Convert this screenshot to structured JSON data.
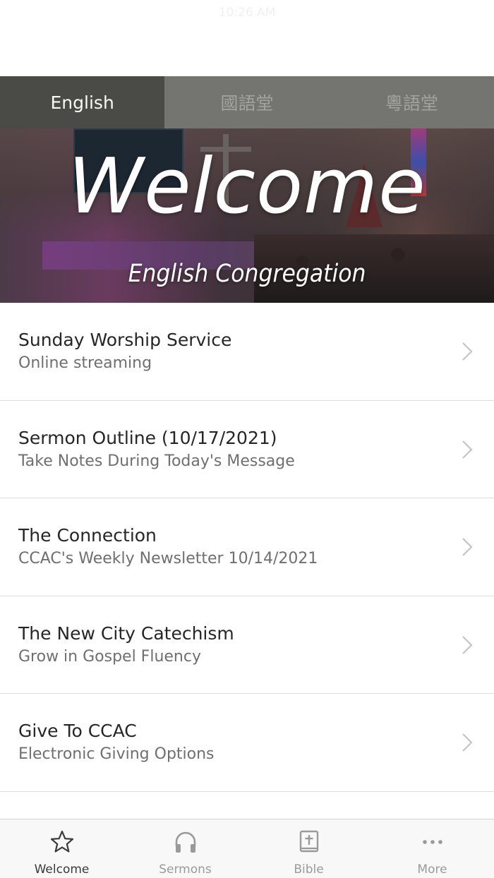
{
  "status_bar": {
    "time": "10:26 AM"
  },
  "segments": [
    {
      "label": "English",
      "active": true
    },
    {
      "label": "國語堂",
      "active": false
    },
    {
      "label": "粵語堂",
      "active": false
    }
  ],
  "hero": {
    "title": "Welcome",
    "subtitle": "English Congregation"
  },
  "list": [
    {
      "title": "Sunday Worship Service",
      "subtitle": "Online streaming"
    },
    {
      "title": "Sermon Outline (10/17/2021)",
      "subtitle": "Take Notes During Today's Message"
    },
    {
      "title": "The Connection",
      "subtitle": "CCAC's Weekly Newsletter 10/14/2021"
    },
    {
      "title": "The New City Catechism",
      "subtitle": "Grow in Gospel Fluency"
    },
    {
      "title": "Give To CCAC",
      "subtitle": "Electronic Giving Options"
    }
  ],
  "tabbar": [
    {
      "label": "Welcome",
      "icon": "star-icon",
      "active": true
    },
    {
      "label": "Sermons",
      "icon": "headphones-icon",
      "active": false
    },
    {
      "label": "Bible",
      "icon": "bible-icon",
      "active": false
    },
    {
      "label": "More",
      "icon": "more-icon",
      "active": false
    }
  ],
  "colors": {
    "segment_active_bg": "#4a4b47",
    "segment_bg": "#747470",
    "tab_active": "#3a3a3a",
    "tab_inactive": "#9a9a9a"
  }
}
